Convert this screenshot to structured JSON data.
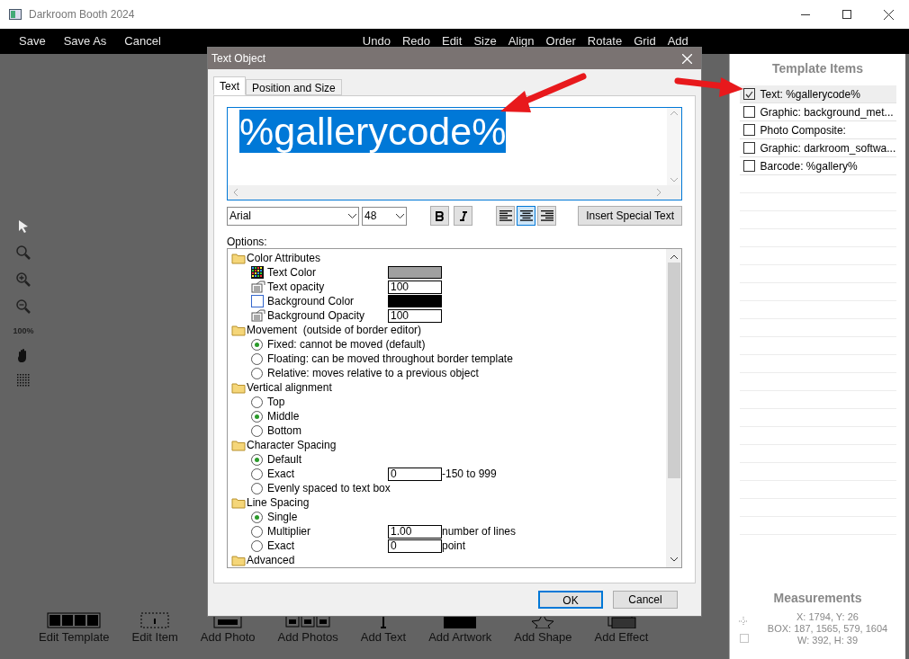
{
  "window": {
    "title": "Darkroom Booth 2024"
  },
  "menu_left": [
    "Save",
    "Save As",
    "Cancel"
  ],
  "menu_right": [
    "Undo",
    "Redo",
    "Edit",
    "Size",
    "Align",
    "Order",
    "Rotate",
    "Grid",
    "Add"
  ],
  "zoom_label": "100%",
  "bottom_toolbar": [
    "Edit Template",
    "Edit Item",
    "Add Photo",
    "Add Photos",
    "Add Text",
    "Add Artwork",
    "Add Shape",
    "Add Effect"
  ],
  "dialog": {
    "title": "Text Object",
    "tabs": [
      {
        "label": "Text",
        "selected": true
      },
      {
        "label": "Position and Size",
        "selected": false
      }
    ],
    "text_value": "%gallerycode%",
    "font": "Arial",
    "size": "48",
    "bold": false,
    "italic": false,
    "alignments": [
      {
        "kind": "left",
        "selected": false
      },
      {
        "kind": "center",
        "selected": true
      },
      {
        "kind": "right",
        "selected": false
      }
    ],
    "insert_button": "Insert Special Text",
    "options_label": "Options:",
    "options": [
      {
        "label": "Color Attributes",
        "children": [
          {
            "kind": "palette",
            "label": "Text Color",
            "color": "#a0a0a0"
          },
          {
            "kind": "field",
            "label": "Text opacity",
            "value": "100"
          },
          {
            "kind": "outline",
            "label": "Background Color",
            "color": "#000000"
          },
          {
            "kind": "field",
            "label": "Background Opacity",
            "value": "100"
          }
        ]
      },
      {
        "label": "Movement  (outside of border editor)",
        "children": [
          {
            "kind": "radio",
            "label": "Fixed:  cannot be moved (default)",
            "selected": true
          },
          {
            "kind": "radio",
            "label": "Floating:  can be moved throughout border template",
            "selected": false
          },
          {
            "kind": "radio",
            "label": "Relative:  moves relative to a previous object",
            "selected": false
          }
        ]
      },
      {
        "label": "Vertical alignment",
        "children": [
          {
            "kind": "radio",
            "label": "Top",
            "selected": false
          },
          {
            "kind": "radio",
            "label": "Middle",
            "selected": true
          },
          {
            "kind": "radio",
            "label": "Bottom",
            "selected": false
          }
        ]
      },
      {
        "label": "Character Spacing",
        "children": [
          {
            "kind": "radio",
            "label": "Default",
            "selected": true
          },
          {
            "kind": "radio",
            "label": "Exact",
            "selected": false,
            "value": "0",
            "suffix": "-150 to 999"
          },
          {
            "kind": "radio",
            "label": "Evenly spaced to text box",
            "selected": false
          }
        ]
      },
      {
        "label": "Line Spacing",
        "children": [
          {
            "kind": "radio",
            "label": "Single",
            "selected": true
          },
          {
            "kind": "radio",
            "label": "Multiplier",
            "selected": false,
            "value": "1.00",
            "suffix": "number of lines"
          },
          {
            "kind": "radio",
            "label": "Exact",
            "selected": false,
            "value": "0",
            "suffix": "point"
          }
        ]
      },
      {
        "label": "Advanced"
      }
    ],
    "buttons": [
      "OK",
      "Cancel"
    ]
  },
  "template_items": {
    "title": "Template Items",
    "items": [
      {
        "label": "Text: %gallerycode%",
        "checked": true,
        "selected": true
      },
      {
        "label": "Graphic: background_met...",
        "checked": false,
        "selected": false
      },
      {
        "label": "Photo Composite:",
        "checked": false,
        "selected": false
      },
      {
        "label": "Graphic: darkroom_softwa...",
        "checked": false,
        "selected": false
      },
      {
        "label": "Barcode: %gallery%",
        "checked": false,
        "selected": false
      }
    ]
  },
  "measurements": {
    "title": "Measurements",
    "lines": [
      "X: 1794, Y: 26",
      "BOX: 187, 1565, 579, 1604",
      "W: 392, H: 39"
    ]
  }
}
